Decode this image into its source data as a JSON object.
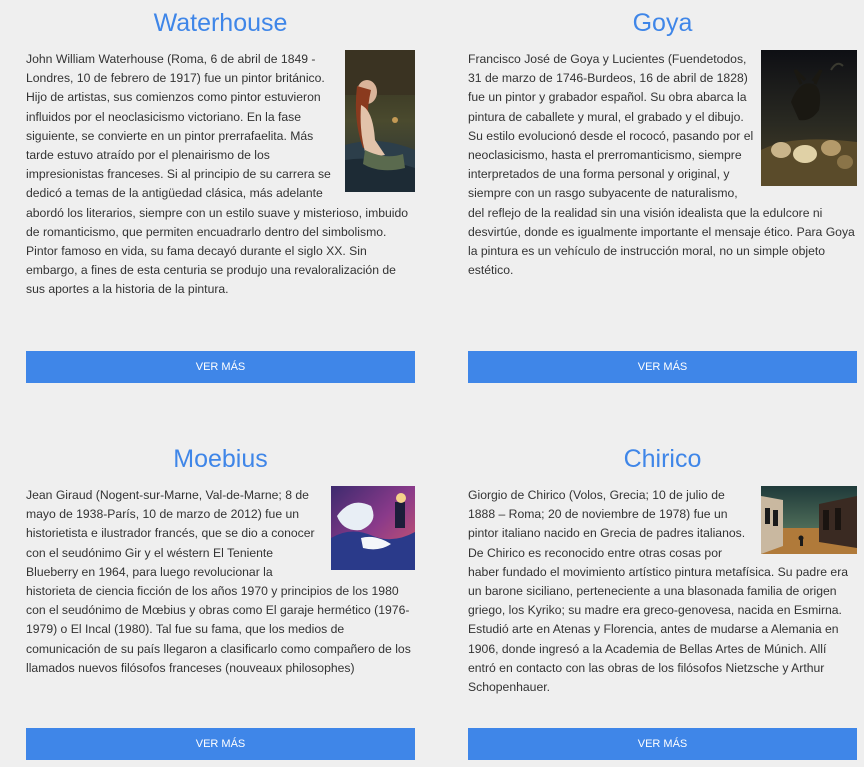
{
  "cards": [
    {
      "name": "Waterhouse",
      "bio": "John William Waterhouse (Roma, 6 de abril de 1849 - Londres, 10 de febrero de 1917) fue un pintor británico. Hijo de artistas, sus comienzos como pintor estuvieron influidos por el neoclasicismo victoriano. En la fase siguiente, se convierte en un pintor prerrafaelita. Más tarde estuvo atraído por el plenairismo de los impresionistas franceses. Si al principio de su carrera se dedicó a temas de la antigüedad clásica, más adelante abordó los literarios, siempre con un estilo suave y misterioso, imbuido de romanticismo, que permiten encuadrarlo dentro del simbolismo. Pintor famoso en vida, su fama decayó durante el siglo XX. Sin embargo, a fines de esta centuria se produjo una revaloralización de sus aportes a la historia de la pintura.",
      "button": "VER MÁS"
    },
    {
      "name": "Goya",
      "bio": "Francisco José de Goya y Lucientes (Fuendetodos, 31 de marzo de 1746-Burdeos, 16 de abril de 1828) fue un pintor y grabador español. Su obra abarca la pintura de caballete y mural, el grabado y el dibujo. Su estilo evolucionó desde el rococó, pasando por el neoclasicismo, hasta el prerromanticismo, siempre interpretados de una forma personal y original, y siempre con un rasgo subyacente de naturalismo, del reflejo de la realidad sin una visión idealista que la edulcore ni desvirtúe, donde es igualmente importante el mensaje ético. Para Goya la pintura es un vehículo de instrucción moral, no un simple objeto estético.",
      "button": "VER MÁS"
    },
    {
      "name": "Moebius",
      "bio": "Jean Giraud (Nogent-sur-Marne, Val-de-Marne; 8 de mayo de 1938-París, 10 de marzo de 2012) fue un historietista e ilustrador francés, que se dio a conocer con el seudónimo Gir y el wéstern El Teniente Blueberry en 1964, para luego revolucionar la historieta de ciencia ficción de los años 1970 y principios de los 1980 con el seudónimo de Mœbius y obras como El garaje hermético (1976-1979) o El Incal (1980). Tal fue su fama, que los medios de comunicación de su país llegaron a clasificarlo como compañero de los llamados nuevos filósofos franceses (nouveaux philosophes)",
      "button": "VER MÁS"
    },
    {
      "name": "Chirico",
      "bio": "Giorgio de Chirico (Volos, Grecia; 10 de julio de 1888 – Roma; 20 de noviembre de 1978) fue un pintor italiano nacido en Grecia de padres italianos. De Chirico es reconocido entre otras cosas por haber fundado el movimiento artístico pintura metafísica. Su padre era un barone siciliano, perteneciente a una blasonada familia de origen griego, los Kyriko; su madre era greco-genovesa, nacida en Esmirna. Estudió arte en Atenas y Florencia, antes de mudarse a Alemania en 1906, donde ingresó a la Academia de Bellas Artes de Múnich. Allí entró en contacto con las obras de los filósofos Nietzsche y Arthur Schopenhauer.",
      "button": "VER MÁS"
    }
  ],
  "colors": {
    "accent": "#3f86e8",
    "background": "#efefef",
    "text": "#333333",
    "button_text": "#ffffff"
  }
}
